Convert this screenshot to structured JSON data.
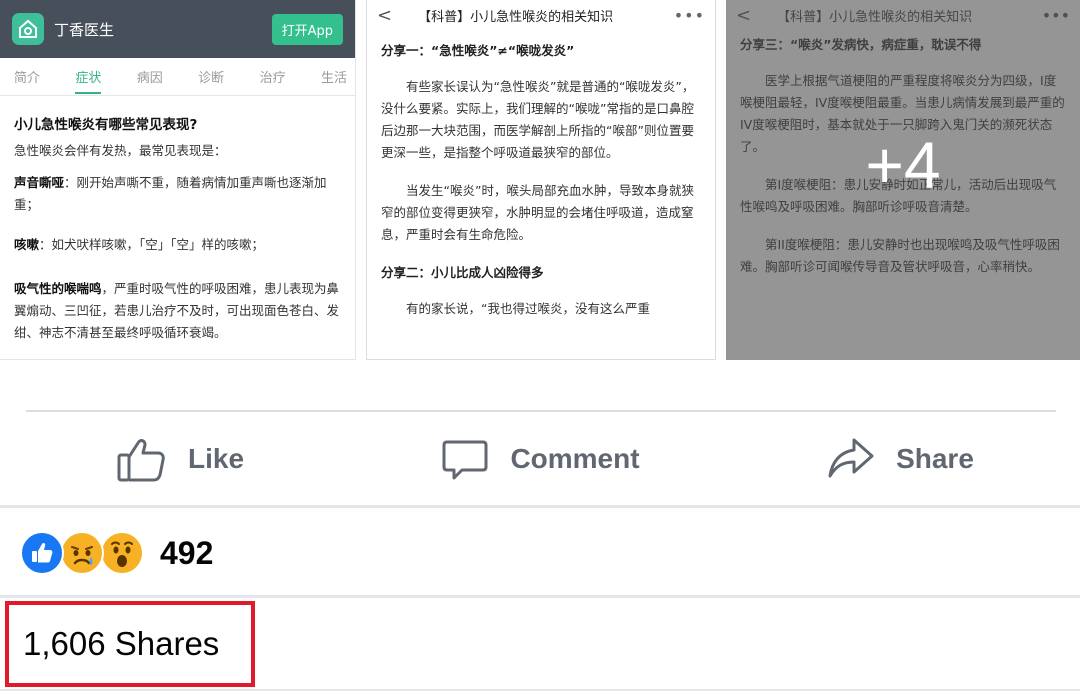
{
  "photos": {
    "thumb1": {
      "app_name": "丁香医生",
      "open_app": "打开App",
      "tabs": [
        "简介",
        "症状",
        "病因",
        "诊断",
        "治疗",
        "生活"
      ],
      "active_tab": "症状",
      "heading": "小儿急性喉炎有哪些常见表现?",
      "intro": "急性喉炎会伴有发热，最常见表现是：",
      "items": [
        {
          "term": "声音嘶哑",
          "text": "：刚开始声嘶不重，随着病情加重声嘶也逐渐加重；"
        },
        {
          "term": "咳嗽",
          "text": "：如犬吠样咳嗽，「空」「空」样的咳嗽；"
        },
        {
          "term": "吸气性的喉喘鸣",
          "text": "，严重时吸气性的呼吸困难，患儿表现为鼻翼煽动、三凹征，若患儿治疗不及时，可出现面色苍白、发绀、神志不清甚至最终呼吸循环衰竭。"
        }
      ]
    },
    "thumb2": {
      "back": "<",
      "title": "【科普】小儿急性喉炎的相关知识",
      "more": "•••",
      "heading1": "分享一：“急性喉炎”≠“喉咙发炎”",
      "para1": "有些家长误认为“急性喉炎”就是普通的“喉咙发炎”，没什么要紧。实际上，我们理解的“喉咙”常指的是口鼻腔后边那一大块范围，而医学解剖上所指的“喉部”则位置要更深一些，是指整个呼吸道最狭窄的部位。",
      "para2": "当发生“喉炎”时，喉头局部充血水肿，导致本身就狭窄的部位变得更狭窄，水肿明显的会堵住呼吸道，造成窒息，严重时会有生命危险。",
      "heading2": "分享二：小儿比成人凶险得多",
      "para3": "有的家长说，“我也得过喉炎，没有这么严重"
    },
    "thumb3": {
      "back": "<",
      "title": "【科普】小儿急性喉炎的相关知识",
      "more": "•••",
      "heading": "分享三：“喉炎”发病快，病症重，耽误不得",
      "para1": "医学上根据气道梗阻的严重程度将喉炎分为四级，I度喉梗阻最轻，IV度喉梗阻最重。当患儿病情发展到最严重的IV度喉梗阻时，基本就处于一只脚跨入鬼门关的濒死状态了。",
      "para2": "第I度喉梗阻：患儿安静时如正常儿，活动后出现吸气性喉鸣及呼吸困难。胸部听诊呼吸音清楚。",
      "para3": "第II度喉梗阻：患儿安静时也出现喉鸣及吸气性呼吸困难。胸部听诊可闻喉传导音及管状呼吸音，心率稍快。",
      "more_count": "+4"
    }
  },
  "actions": {
    "like": "Like",
    "comment": "Comment",
    "share": "Share"
  },
  "reactions": {
    "icons": [
      "like-icon",
      "sad-icon",
      "wow-icon"
    ],
    "count": "492"
  },
  "shares": {
    "label": "1,606 Shares"
  },
  "colors": {
    "action_gray": "#606770",
    "like_blue": "#1877f2",
    "emoji_yellow": "#f7b125",
    "highlight_red": "#e0192b",
    "app_green": "#33c08e"
  }
}
